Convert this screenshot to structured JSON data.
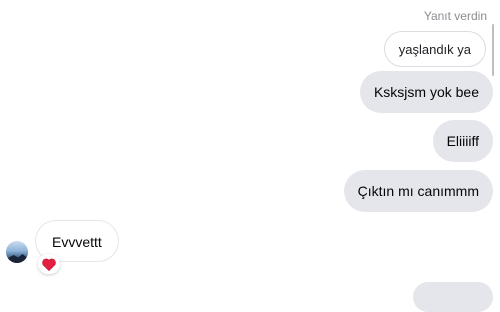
{
  "reply_label": "Yanıt verdin",
  "quoted_message": "yaşlandık ya",
  "outgoing_messages": [
    "Ksksjsm yok bee",
    "Eliiiiff",
    "Çıktın mı canımmm"
  ],
  "incoming_message": "Evvvettt",
  "reaction_icon": "heart-icon",
  "colors": {
    "outgoing_bubble": "#e4e6eb",
    "reaction_heart": "#e41e3f",
    "meta_text": "#8a8d91"
  }
}
